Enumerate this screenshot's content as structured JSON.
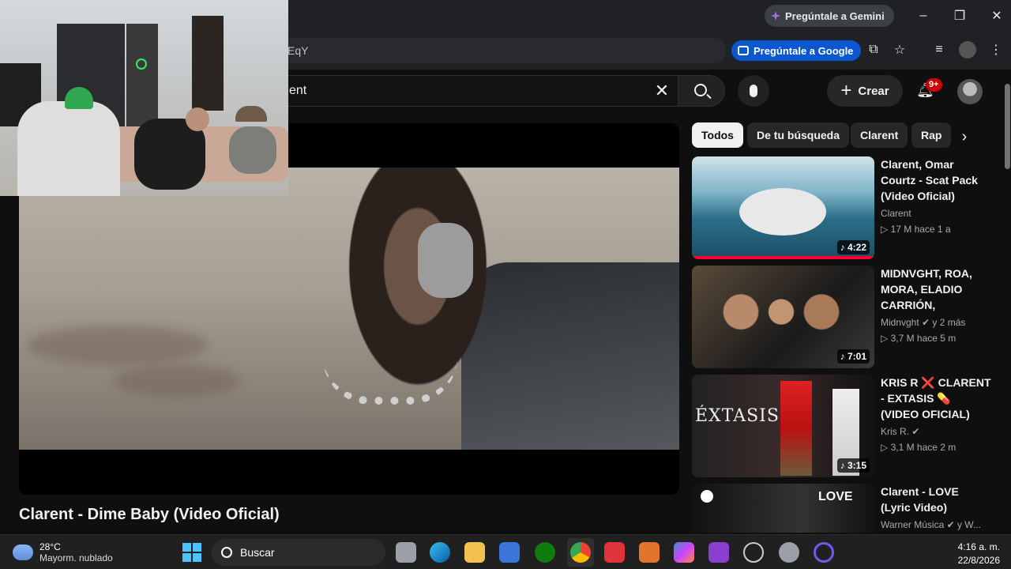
{
  "browser": {
    "gemini_button": "Pregúntale a Gemini",
    "omnibox_text": "EqY",
    "ask_google_button": "Pregúntale a Google",
    "minimize": "–",
    "restore": "❐",
    "close": "✕"
  },
  "youtube": {
    "search_value": "ent",
    "create_label": "Crear",
    "notifications_badge": "9+",
    "video_title": "Clarent - Dime Baby (Video Oficial)",
    "chips": [
      "Todos",
      "De tu búsqueda",
      "Clarent",
      "Rap"
    ],
    "recommendations": [
      {
        "title": "Clarent, Omar Courtz - Scat Pack (Video Oficial)",
        "channel": "Clarent",
        "meta": "▷ 17 M hace 1 a",
        "duration": "♪ 4:22"
      },
      {
        "title": "MIDNVGHT, ROA, MORA, ELADIO CARRIÓN, CLAREN...",
        "channel": "Midnvght ✔ y 2 más",
        "meta": "▷ 3,7 M hace 5 m",
        "duration": "♪ 7:01"
      },
      {
        "title": "KRIS R ❌ CLARENT - EXTASIS 💊 (VIDEO OFICIAL)",
        "channel": "Kris R. ✔",
        "meta": "▷ 3,1 M hace 2 m",
        "duration": "♪ 3:15"
      },
      {
        "title": "Clarent - LOVE (Lyric Video)",
        "channel": "Warner Música ✔ y W...",
        "meta": "",
        "duration": ""
      }
    ]
  },
  "taskbar": {
    "temperature": "28°C",
    "weather_text": "Mayorm. nublado",
    "search_label": "Buscar",
    "time": "4:16 a. m.",
    "date": "22/8/2026"
  },
  "colors": {
    "accent_red": "#ff0033",
    "ask_google_blue": "#0b57d0"
  }
}
